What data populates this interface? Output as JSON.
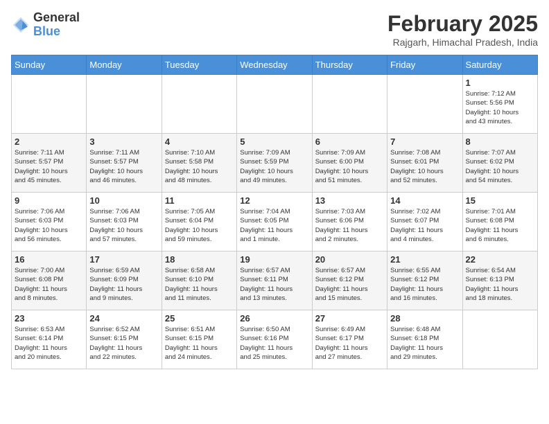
{
  "header": {
    "logo_general": "General",
    "logo_blue": "Blue",
    "month_year": "February 2025",
    "location": "Rajgarh, Himachal Pradesh, India"
  },
  "weekdays": [
    "Sunday",
    "Monday",
    "Tuesday",
    "Wednesday",
    "Thursday",
    "Friday",
    "Saturday"
  ],
  "weeks": [
    [
      {
        "day": "",
        "info": ""
      },
      {
        "day": "",
        "info": ""
      },
      {
        "day": "",
        "info": ""
      },
      {
        "day": "",
        "info": ""
      },
      {
        "day": "",
        "info": ""
      },
      {
        "day": "",
        "info": ""
      },
      {
        "day": "1",
        "info": "Sunrise: 7:12 AM\nSunset: 5:56 PM\nDaylight: 10 hours\nand 43 minutes."
      }
    ],
    [
      {
        "day": "2",
        "info": "Sunrise: 7:11 AM\nSunset: 5:57 PM\nDaylight: 10 hours\nand 45 minutes."
      },
      {
        "day": "3",
        "info": "Sunrise: 7:11 AM\nSunset: 5:57 PM\nDaylight: 10 hours\nand 46 minutes."
      },
      {
        "day": "4",
        "info": "Sunrise: 7:10 AM\nSunset: 5:58 PM\nDaylight: 10 hours\nand 48 minutes."
      },
      {
        "day": "5",
        "info": "Sunrise: 7:09 AM\nSunset: 5:59 PM\nDaylight: 10 hours\nand 49 minutes."
      },
      {
        "day": "6",
        "info": "Sunrise: 7:09 AM\nSunset: 6:00 PM\nDaylight: 10 hours\nand 51 minutes."
      },
      {
        "day": "7",
        "info": "Sunrise: 7:08 AM\nSunset: 6:01 PM\nDaylight: 10 hours\nand 52 minutes."
      },
      {
        "day": "8",
        "info": "Sunrise: 7:07 AM\nSunset: 6:02 PM\nDaylight: 10 hours\nand 54 minutes."
      }
    ],
    [
      {
        "day": "9",
        "info": "Sunrise: 7:06 AM\nSunset: 6:03 PM\nDaylight: 10 hours\nand 56 minutes."
      },
      {
        "day": "10",
        "info": "Sunrise: 7:06 AM\nSunset: 6:03 PM\nDaylight: 10 hours\nand 57 minutes."
      },
      {
        "day": "11",
        "info": "Sunrise: 7:05 AM\nSunset: 6:04 PM\nDaylight: 10 hours\nand 59 minutes."
      },
      {
        "day": "12",
        "info": "Sunrise: 7:04 AM\nSunset: 6:05 PM\nDaylight: 11 hours\nand 1 minute."
      },
      {
        "day": "13",
        "info": "Sunrise: 7:03 AM\nSunset: 6:06 PM\nDaylight: 11 hours\nand 2 minutes."
      },
      {
        "day": "14",
        "info": "Sunrise: 7:02 AM\nSunset: 6:07 PM\nDaylight: 11 hours\nand 4 minutes."
      },
      {
        "day": "15",
        "info": "Sunrise: 7:01 AM\nSunset: 6:08 PM\nDaylight: 11 hours\nand 6 minutes."
      }
    ],
    [
      {
        "day": "16",
        "info": "Sunrise: 7:00 AM\nSunset: 6:08 PM\nDaylight: 11 hours\nand 8 minutes."
      },
      {
        "day": "17",
        "info": "Sunrise: 6:59 AM\nSunset: 6:09 PM\nDaylight: 11 hours\nand 9 minutes."
      },
      {
        "day": "18",
        "info": "Sunrise: 6:58 AM\nSunset: 6:10 PM\nDaylight: 11 hours\nand 11 minutes."
      },
      {
        "day": "19",
        "info": "Sunrise: 6:57 AM\nSunset: 6:11 PM\nDaylight: 11 hours\nand 13 minutes."
      },
      {
        "day": "20",
        "info": "Sunrise: 6:57 AM\nSunset: 6:12 PM\nDaylight: 11 hours\nand 15 minutes."
      },
      {
        "day": "21",
        "info": "Sunrise: 6:55 AM\nSunset: 6:12 PM\nDaylight: 11 hours\nand 16 minutes."
      },
      {
        "day": "22",
        "info": "Sunrise: 6:54 AM\nSunset: 6:13 PM\nDaylight: 11 hours\nand 18 minutes."
      }
    ],
    [
      {
        "day": "23",
        "info": "Sunrise: 6:53 AM\nSunset: 6:14 PM\nDaylight: 11 hours\nand 20 minutes."
      },
      {
        "day": "24",
        "info": "Sunrise: 6:52 AM\nSunset: 6:15 PM\nDaylight: 11 hours\nand 22 minutes."
      },
      {
        "day": "25",
        "info": "Sunrise: 6:51 AM\nSunset: 6:15 PM\nDaylight: 11 hours\nand 24 minutes."
      },
      {
        "day": "26",
        "info": "Sunrise: 6:50 AM\nSunset: 6:16 PM\nDaylight: 11 hours\nand 25 minutes."
      },
      {
        "day": "27",
        "info": "Sunrise: 6:49 AM\nSunset: 6:17 PM\nDaylight: 11 hours\nand 27 minutes."
      },
      {
        "day": "28",
        "info": "Sunrise: 6:48 AM\nSunset: 6:18 PM\nDaylight: 11 hours\nand 29 minutes."
      },
      {
        "day": "",
        "info": ""
      }
    ]
  ]
}
